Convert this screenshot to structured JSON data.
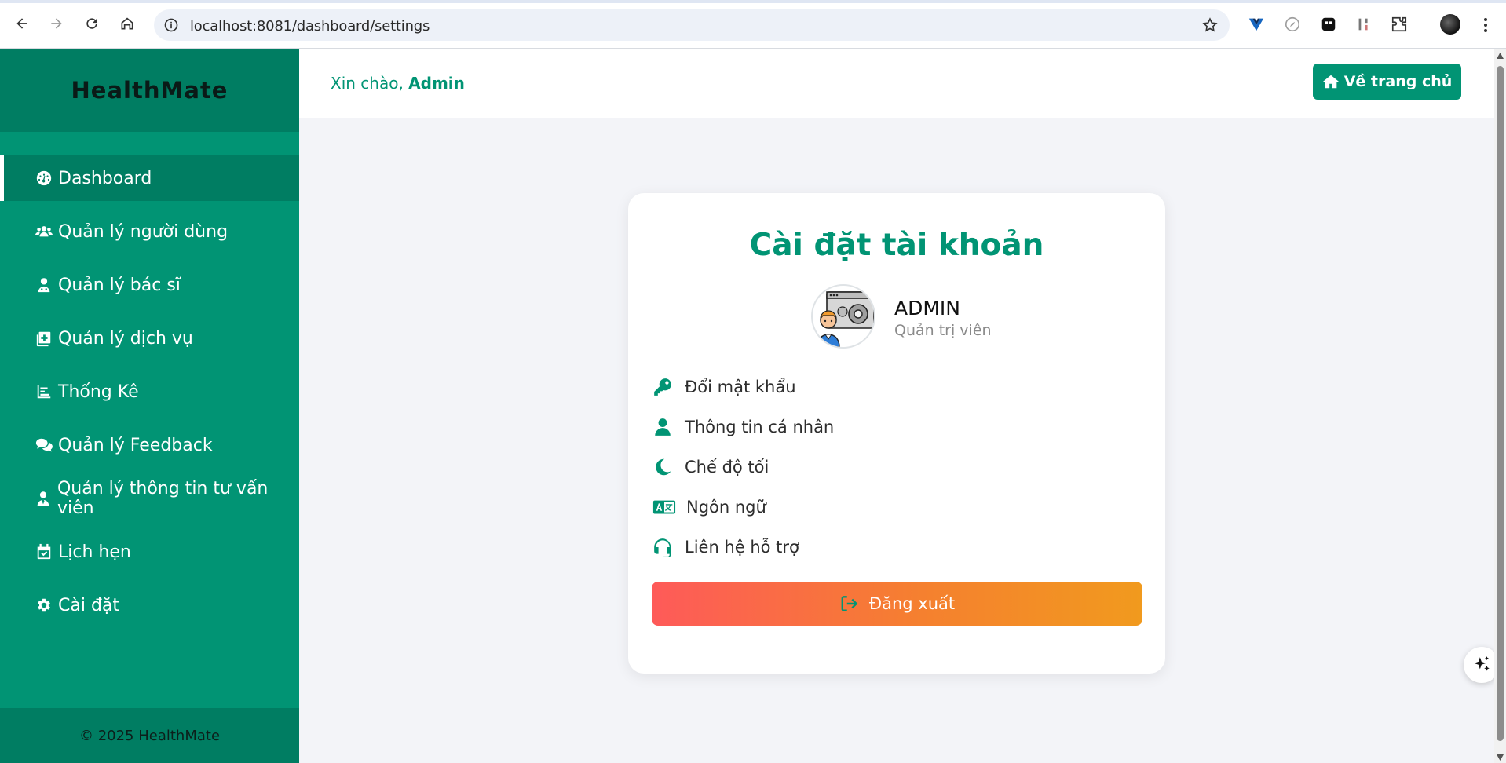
{
  "browser": {
    "url": "localhost:8081/dashboard/settings"
  },
  "sidebar": {
    "brand": "HealthMate",
    "items": [
      {
        "label": "Dashboard",
        "icon": "gauge-icon",
        "active": true
      },
      {
        "label": "Quản lý người dùng",
        "icon": "users-icon",
        "active": false
      },
      {
        "label": "Quản lý bác sĩ",
        "icon": "doctor-icon",
        "active": false
      },
      {
        "label": "Quản lý dịch vụ",
        "icon": "medical-plus-icon",
        "active": false
      },
      {
        "label": "Thống Kê",
        "icon": "chart-icon",
        "active": false
      },
      {
        "label": "Quản lý Feedback",
        "icon": "comments-icon",
        "active": false
      },
      {
        "label": "Quản lý thông tin tư vấn viên",
        "icon": "user-tie-icon",
        "active": false
      },
      {
        "label": "Lịch hẹn",
        "icon": "calendar-check-icon",
        "active": false
      },
      {
        "label": "Cài đặt",
        "icon": "gear-icon",
        "active": false
      }
    ],
    "footer": "© 2025 HealthMate"
  },
  "topbar": {
    "greeting_prefix": "Xin chào,",
    "greeting_name": "Admin",
    "home_button": "Về trang chủ"
  },
  "settings": {
    "title": "Cài đặt tài khoản",
    "user_name": "ADMIN",
    "user_role": "Quản trị viên",
    "options": [
      {
        "label": "Đổi mật khẩu",
        "icon": "key-icon"
      },
      {
        "label": "Thông tin cá nhân",
        "icon": "user-icon"
      },
      {
        "label": "Chế độ tối",
        "icon": "moon-icon"
      },
      {
        "label": "Ngôn ngữ",
        "icon": "language-icon"
      },
      {
        "label": "Liên hệ hỗ trợ",
        "icon": "headset-icon"
      }
    ],
    "logout_label": "Đăng xuất"
  },
  "colors": {
    "primary": "#019474",
    "primary_dark": "#007d62",
    "logout_gradient_start": "#fe5a59",
    "logout_gradient_end": "#f19a1e"
  }
}
